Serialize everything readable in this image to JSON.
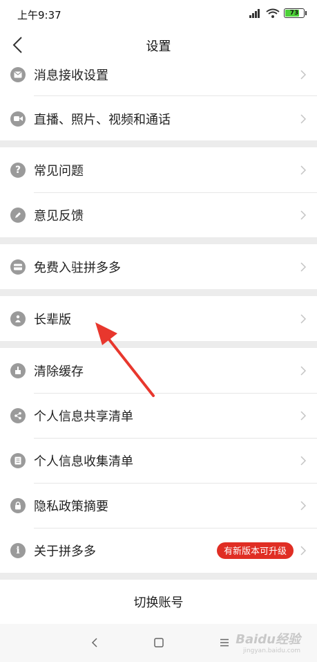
{
  "status_bar": {
    "time": "上午9:37",
    "battery_level": "73",
    "battery_fraction": 0.73
  },
  "header": {
    "title": "设置"
  },
  "settings": {
    "items": [
      {
        "label": "消息接收设置",
        "icon": "mail-icon"
      },
      {
        "label": "直播、照片、视频和通话",
        "icon": "video-camera-icon"
      },
      {
        "label": "常见问题",
        "icon": "question-icon"
      },
      {
        "label": "意见反馈",
        "icon": "pencil-icon"
      },
      {
        "label": "免费入驻拼多多",
        "icon": "store-card-icon"
      },
      {
        "label": "长辈版",
        "icon": "elder-person-icon"
      },
      {
        "label": "清除缓存",
        "icon": "broom-icon"
      },
      {
        "label": "个人信息共享清单",
        "icon": "share-icon"
      },
      {
        "label": "个人信息收集清单",
        "icon": "list-icon"
      },
      {
        "label": "隐私政策摘要",
        "icon": "lock-icon"
      },
      {
        "label": "关于拼多多",
        "icon": "info-icon",
        "badge": "有新版本可升级"
      }
    ]
  },
  "footer": {
    "switch_account": "切换账号"
  },
  "watermark": {
    "brand": "Baidu经验",
    "url": "jingyan.baidu.com"
  },
  "colors": {
    "accent_red": "#e02e24",
    "icon_gray": "#9a9a9a",
    "background": "#ececec"
  }
}
